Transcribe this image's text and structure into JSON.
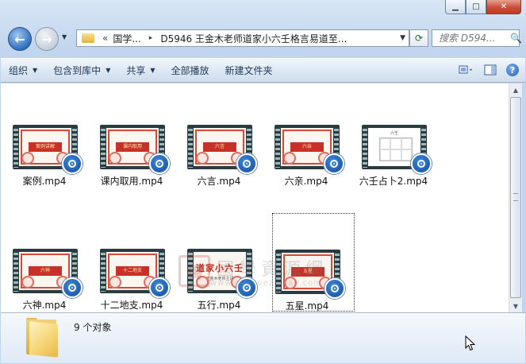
{
  "window": {
    "minimize_glyph": "▁",
    "maximize_glyph": "□",
    "close_glyph": "✕"
  },
  "nav": {
    "back_glyph": "←",
    "forward_glyph": "→",
    "history_glyph": "▼",
    "address": {
      "overflow": "«",
      "crumbs": [
        "国学...",
        "D5946 王金木老师道家小六壬格言易道至..."
      ],
      "separator": "▸",
      "dropdown_glyph": "▼"
    },
    "refresh_glyph": "⟳",
    "search_placeholder": "搜索 D594...",
    "search_glyph": "🔍"
  },
  "toolbar": {
    "items": [
      {
        "label": "组织",
        "dropdown": true
      },
      {
        "label": "包含到库中",
        "dropdown": true
      },
      {
        "label": "共享",
        "dropdown": true
      },
      {
        "label": "全部播放",
        "dropdown": false
      },
      {
        "label": "新建文件夹",
        "dropdown": false
      }
    ],
    "dd_glyph": "▼",
    "help_glyph": "?"
  },
  "files": [
    {
      "name": "案例.mp4",
      "thumb": "banner",
      "caption": "案例讲解"
    },
    {
      "name": "课内取用.mp4",
      "thumb": "banner",
      "caption": "课内取用"
    },
    {
      "name": "六言.mp4",
      "thumb": "banner",
      "caption": "六言"
    },
    {
      "name": "六亲.mp4",
      "thumb": "banner",
      "caption": "六亲"
    },
    {
      "name": "六壬占卜2.mp4",
      "thumb": "white",
      "caption": "六壬"
    },
    {
      "name": "六神.mp4",
      "thumb": "banner",
      "caption": "六神"
    },
    {
      "name": "十二地支.mp4",
      "thumb": "banner",
      "caption": "十二地支"
    },
    {
      "name": "五行.mp4",
      "thumb": "title",
      "caption": "道家小六壬",
      "subcaption": "王金木老师主讲"
    },
    {
      "name": "五星.mp4",
      "thumb": "banner",
      "caption": "五星",
      "selected": true
    }
  ],
  "watermark": {
    "logo": "嗨",
    "text": "國學資源網",
    "url": "www.guoxueziyuan.com"
  },
  "details": {
    "count_text": "9 个对象"
  },
  "scrollbar": {
    "up_glyph": "▲",
    "down_glyph": "▼"
  },
  "colors": {
    "accent": "#1e395b",
    "film": "#2a3c41",
    "banner_red": "#c8312a",
    "badge_blue": "#124d9c"
  }
}
